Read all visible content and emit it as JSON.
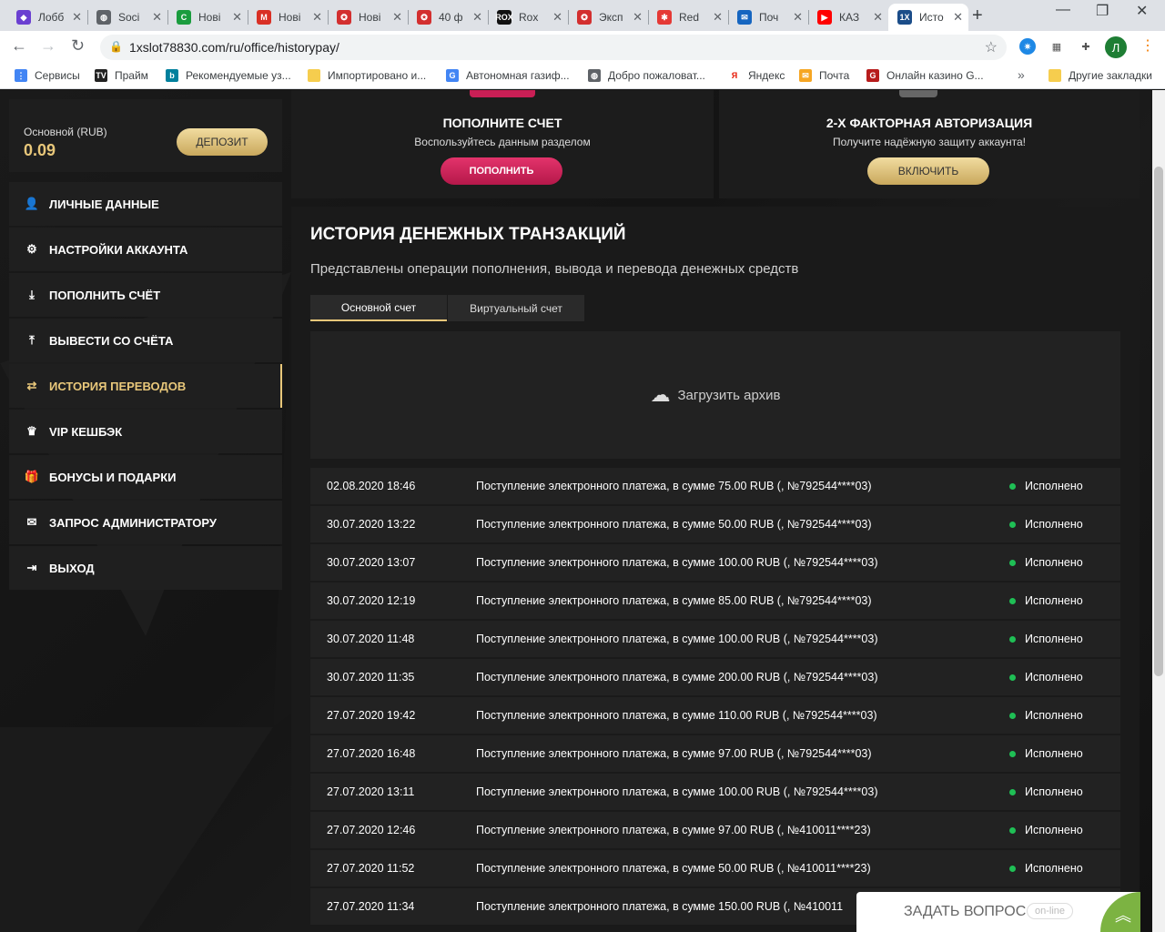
{
  "browser": {
    "tabs": [
      {
        "title": "Лобб",
        "icon": "layers-icon",
        "color": "#6a3fd1",
        "glyph": "◆"
      },
      {
        "title": "Soci",
        "icon": "globe-icon",
        "color": "#5f6368",
        "glyph": "◍"
      },
      {
        "title": "Нові",
        "icon": "green-c-icon",
        "color": "#1a9c3e",
        "glyph": "C"
      },
      {
        "title": "Нові",
        "icon": "gmail-icon",
        "color": "#d93025",
        "glyph": "M"
      },
      {
        "title": "Нові",
        "icon": "roulette-icon",
        "color": "#d32f2f",
        "glyph": "✪"
      },
      {
        "title": "40 ф",
        "icon": "roulette-icon",
        "color": "#d32f2f",
        "glyph": "✪"
      },
      {
        "title": "Rox",
        "icon": "rox-icon",
        "color": "#111111",
        "glyph": "ROX"
      },
      {
        "title": "Эксп",
        "icon": "roulette-icon",
        "color": "#d32f2f",
        "glyph": "✪"
      },
      {
        "title": "Red",
        "icon": "red-star-icon",
        "color": "#e53935",
        "glyph": "✱"
      },
      {
        "title": "Поч",
        "icon": "mail-icon",
        "color": "#1565c0",
        "glyph": "✉"
      },
      {
        "title": "КАЗ",
        "icon": "youtube-icon",
        "color": "#ff0000",
        "glyph": "▶"
      },
      {
        "title": "Исто",
        "icon": "1x-icon",
        "color": "#1b4d89",
        "glyph": "1X"
      }
    ],
    "new_tab": "+",
    "url": "1xslot78830.com/ru/office/historypay/",
    "profile_letter": "Л",
    "bookmarks": [
      {
        "label": "Сервисы",
        "icon": "apps-icon",
        "color": "#4285f4",
        "glyph": "⋮"
      },
      {
        "label": "Прайм",
        "icon": "tv-icon",
        "color": "#222222",
        "glyph": "TV"
      },
      {
        "label": "Рекомендуемые уз...",
        "icon": "bing-icon",
        "color": "#00809d",
        "glyph": "b"
      },
      {
        "label": "Импортировано и...",
        "icon": "folder-icon",
        "color": "#f6cd4e",
        "glyph": ""
      },
      {
        "label": "Автономная газиф...",
        "icon": "g-icon",
        "color": "#4285f4",
        "glyph": "G"
      },
      {
        "label": "Добро пожаловат...",
        "icon": "globe-icon",
        "color": "#5f6368",
        "glyph": "◍"
      },
      {
        "label": "Яндекс",
        "icon": "yandex-icon",
        "color": "#ffffff",
        "glyph": "Я"
      },
      {
        "label": "Почта",
        "icon": "mail-icon",
        "color": "#f6a623",
        "glyph": "✉"
      },
      {
        "label": "Онлайн казино G...",
        "icon": "casino-icon",
        "color": "#b71c1c",
        "glyph": "G"
      }
    ],
    "bookmarks_more": "»",
    "other_bookmarks": "Другие закладки"
  },
  "account": {
    "balance_label": "Основной (RUB)",
    "balance_value": "0.09",
    "deposit_label": "ДЕПОЗИТ"
  },
  "menu": [
    {
      "label": "ЛИЧНЫЕ ДАННЫЕ",
      "icon": "user-add-icon",
      "glyph": "👤"
    },
    {
      "label": "НАСТРОЙКИ АККАУНТА",
      "icon": "gears-icon",
      "glyph": "⚙"
    },
    {
      "label": "ПОПОЛНИТЬ СЧЁТ",
      "icon": "download-icon",
      "glyph": "⤓"
    },
    {
      "label": "ВЫВЕСТИ СО СЧЁТА",
      "icon": "upload-icon",
      "glyph": "⤒"
    },
    {
      "label": "ИСТОРИЯ ПЕРЕВОДОВ",
      "icon": "transfer-icon",
      "glyph": "⇄"
    },
    {
      "label": "VIP КЕШБЭК",
      "icon": "crown-icon",
      "glyph": "♛"
    },
    {
      "label": "БОНУСЫ И ПОДАРКИ",
      "icon": "gift-icon",
      "glyph": "🎁"
    },
    {
      "label": "ЗАПРОС АДМИНИСТРАТОРУ",
      "icon": "envelope-icon",
      "glyph": "✉"
    },
    {
      "label": "ВЫХОД",
      "icon": "logout-icon",
      "glyph": "⇥"
    }
  ],
  "cards": {
    "topup": {
      "title": "ПОПОЛНИТЕ СЧЕТ",
      "subtitle": "Воспользуйтесь данным разделом",
      "button": "ПОПОЛНИТЬ"
    },
    "twofa": {
      "title": "2-Х ФАКТОРНАЯ АВТОРИЗАЦИЯ",
      "subtitle": "Получите надёжную защиту аккаунта!",
      "button": "ВКЛЮЧИТЬ"
    }
  },
  "history": {
    "title": "ИСТОРИЯ ДЕНЕЖНЫХ ТРАНЗАКЦИЙ",
    "subtitle": "Представлены операции пополнения, вывода и перевода денежных средств",
    "tabs": [
      "Основной счет",
      "Виртуальный счет"
    ],
    "archive_label": "Загрузить архив",
    "rows": [
      {
        "date": "02.08.2020 18:46",
        "desc": "Поступление электронного платежа, в сумме 75.00 RUB (, №792544****03)",
        "status": "Исполнено"
      },
      {
        "date": "30.07.2020 13:22",
        "desc": "Поступление электронного платежа, в сумме 50.00 RUB (, №792544****03)",
        "status": "Исполнено"
      },
      {
        "date": "30.07.2020 13:07",
        "desc": "Поступление электронного платежа, в сумме 100.00 RUB (, №792544****03)",
        "status": "Исполнено"
      },
      {
        "date": "30.07.2020 12:19",
        "desc": "Поступление электронного платежа, в сумме 85.00 RUB (, №792544****03)",
        "status": "Исполнено"
      },
      {
        "date": "30.07.2020 11:48",
        "desc": "Поступление электронного платежа, в сумме 100.00 RUB (, №792544****03)",
        "status": "Исполнено"
      },
      {
        "date": "30.07.2020 11:35",
        "desc": "Поступление электронного платежа, в сумме 200.00 RUB (, №792544****03)",
        "status": "Исполнено"
      },
      {
        "date": "27.07.2020 19:42",
        "desc": "Поступление электронного платежа, в сумме 110.00 RUB (, №792544****03)",
        "status": "Исполнено"
      },
      {
        "date": "27.07.2020 16:48",
        "desc": "Поступление электронного платежа, в сумме 97.00 RUB (, №792544****03)",
        "status": "Исполнено"
      },
      {
        "date": "27.07.2020 13:11",
        "desc": "Поступление электронного платежа, в сумме 100.00 RUB (, №792544****03)",
        "status": "Исполнено"
      },
      {
        "date": "27.07.2020 12:46",
        "desc": "Поступление электронного платежа, в сумме 97.00 RUB (, №410011****23)",
        "status": "Исполнено"
      },
      {
        "date": "27.07.2020 11:52",
        "desc": "Поступление электронного платежа, в сумме 50.00 RUB (, №410011****23)",
        "status": "Исполнено"
      },
      {
        "date": "27.07.2020 11:34",
        "desc": "Поступление электронного платежа, в сумме 150.00 RUB (, №410011",
        "status": ""
      }
    ]
  },
  "chat": {
    "label": "ЗАДАТЬ ВОПРОС",
    "status": "on-line",
    "icon": "chevrons-up-icon"
  },
  "colors": {
    "gold": "#e8c77a",
    "pink": "#c91f55",
    "status_green": "#1fbf55"
  }
}
